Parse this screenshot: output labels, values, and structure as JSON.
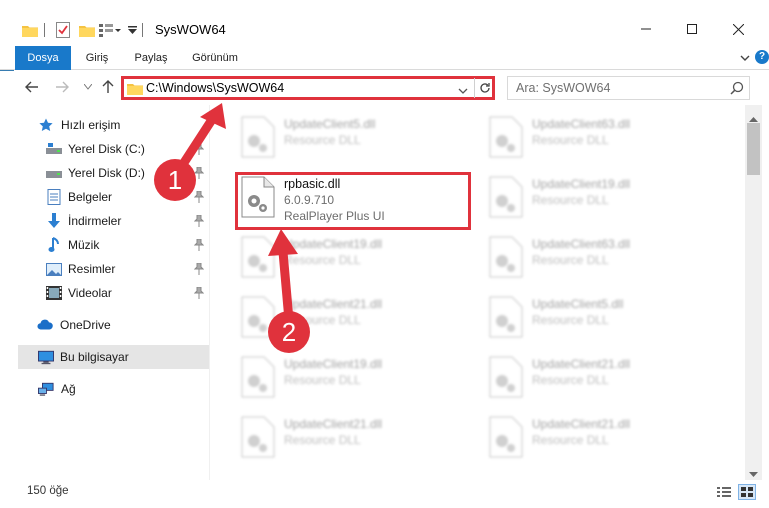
{
  "window": {
    "title": "SysWOW64",
    "minimize_label": "—",
    "maximize_label": "☐",
    "close_label": "✕"
  },
  "ribbon": {
    "tabs": [
      "Dosya",
      "Giriş",
      "Paylaş",
      "Görünüm"
    ],
    "help_label": "?"
  },
  "address": {
    "path": "C:\\Windows\\SysWOW64"
  },
  "search": {
    "placeholder": "Ara: SysWOW64"
  },
  "sidebar": {
    "quick_access": "Hızlı erişim",
    "items": [
      {
        "label": "Yerel Disk (C:)",
        "icon": "drive-icon",
        "pinned": true
      },
      {
        "label": "Yerel Disk (D:)",
        "icon": "drive-icon",
        "pinned": true
      },
      {
        "label": "Belgeler",
        "icon": "documents-icon",
        "pinned": true
      },
      {
        "label": "İndirmeler",
        "icon": "downloads-icon",
        "pinned": true
      },
      {
        "label": "Müzik",
        "icon": "music-icon",
        "pinned": true
      },
      {
        "label": "Resimler",
        "icon": "pictures-icon",
        "pinned": true
      },
      {
        "label": "Videolar",
        "icon": "videos-icon",
        "pinned": true
      }
    ],
    "onedrive": "OneDrive",
    "this_pc": "Bu bilgisayar",
    "network": "Ağ"
  },
  "files": {
    "main": {
      "name": "rpbasic.dll",
      "version": "6.0.9.710",
      "description": "RealPlayer Plus UI"
    },
    "col1": [
      {
        "name": "UpdateClient5.dll",
        "desc": "Resource DLL"
      },
      {
        "name": "UpdateClient19.dll",
        "desc": "Resource DLL"
      },
      {
        "name": "UpdateClient21.dll",
        "desc": "Resource DLL"
      },
      {
        "name": "UpdateClient19.dll",
        "desc": "Resource DLL"
      },
      {
        "name": "UpdateClient21.dll",
        "desc": "Resource DLL"
      }
    ],
    "col2": [
      {
        "name": "UpdateClient63.dll",
        "desc": "Resource DLL"
      },
      {
        "name": "UpdateClient19.dll",
        "desc": "Resource DLL"
      },
      {
        "name": "UpdateClient63.dll",
        "desc": "Resource DLL"
      },
      {
        "name": "UpdateClient5.dll",
        "desc": "Resource DLL"
      },
      {
        "name": "UpdateClient21.dll",
        "desc": "Resource DLL"
      },
      {
        "name": "UpdateClient21.dll",
        "desc": "Resource DLL"
      }
    ]
  },
  "status": {
    "item_count": "150 öğe"
  },
  "annotations": {
    "step1": "1",
    "step2": "2",
    "highlight_color": "#e0323c"
  },
  "colors": {
    "accent": "#1979ca",
    "selected_bg": "#e5e5e5"
  }
}
